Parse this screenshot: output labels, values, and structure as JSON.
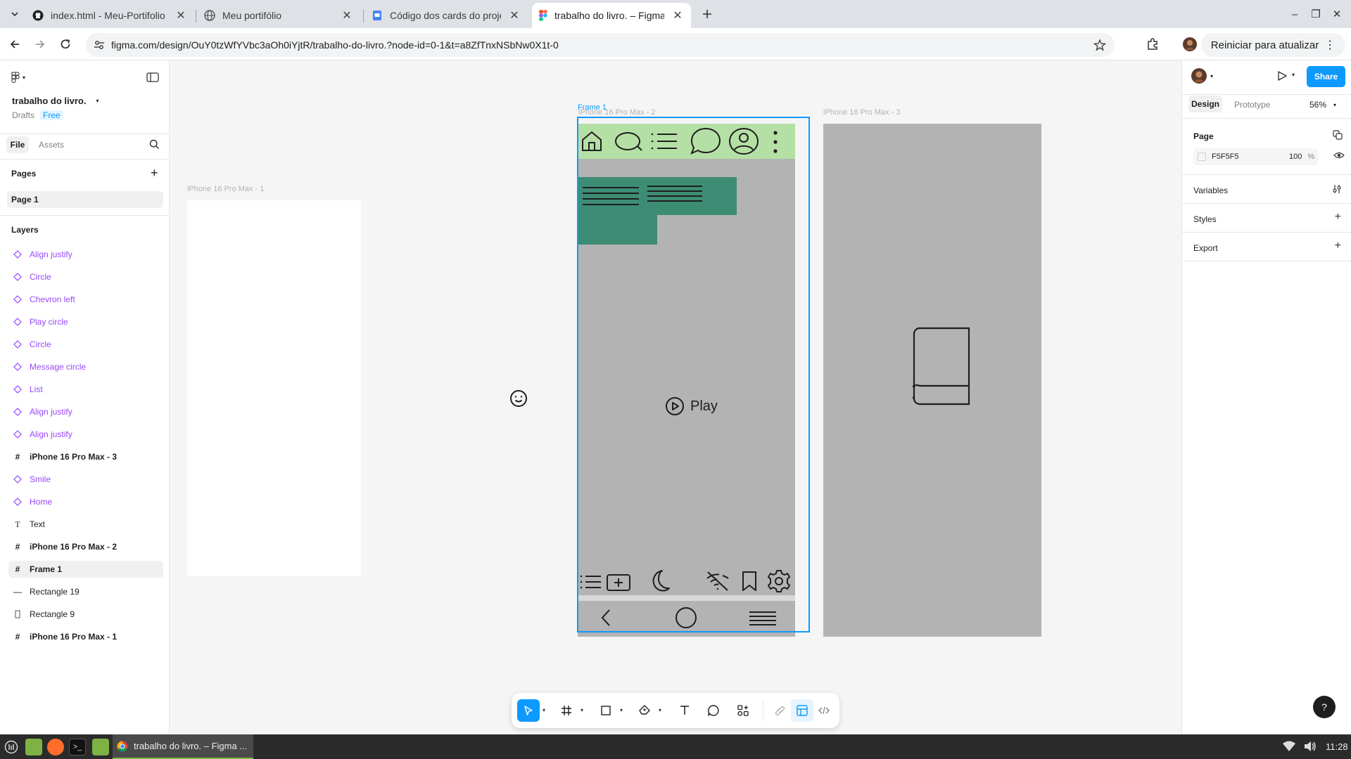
{
  "browser": {
    "tabs": [
      {
        "title": "index.html - Meu-Portifolio",
        "icon": "github-icon",
        "active": false
      },
      {
        "title": "Meu portifólio",
        "icon": "globe-icon",
        "active": false
      },
      {
        "title": "Código dos cards do projeto",
        "icon": "slides-icon",
        "active": false
      },
      {
        "title": "trabalho do livro. – Figma",
        "icon": "figma-icon",
        "active": true
      }
    ],
    "url": "figma.com/design/OuY0tzWfYVbc3aOh0iYjtR/trabalho-do-livro.?node-id=0-1&t=a8ZfTnxNSbNw0X1t-0",
    "update_button": "Reiniciar para atualizar"
  },
  "left_panel": {
    "file_name": "trabalho do livro.",
    "location": "Drafts",
    "plan_badge": "Free",
    "tabs": [
      "File",
      "Assets"
    ],
    "pages_heading": "Pages",
    "pages": [
      "Page 1"
    ],
    "layers_heading": "Layers",
    "layers": [
      {
        "name": "Align justify",
        "kind": "component"
      },
      {
        "name": "Circle",
        "kind": "component"
      },
      {
        "name": "Chevron left",
        "kind": "component"
      },
      {
        "name": "Play circle",
        "kind": "component"
      },
      {
        "name": "Circle",
        "kind": "component"
      },
      {
        "name": "Message circle",
        "kind": "component"
      },
      {
        "name": "List",
        "kind": "component"
      },
      {
        "name": "Align justify",
        "kind": "component"
      },
      {
        "name": "Align justify",
        "kind": "component"
      },
      {
        "name": "iPhone 16 Pro Max - 3",
        "kind": "frame"
      },
      {
        "name": "Smile",
        "kind": "component"
      },
      {
        "name": "Home",
        "kind": "component"
      },
      {
        "name": "Text",
        "kind": "text"
      },
      {
        "name": "iPhone 16 Pro Max - 2",
        "kind": "frame"
      },
      {
        "name": "Frame 1",
        "kind": "frame",
        "selected": true
      },
      {
        "name": "Rectangle 19",
        "kind": "line"
      },
      {
        "name": "Rectangle 9",
        "kind": "rect"
      },
      {
        "name": "iPhone 16 Pro Max - 1",
        "kind": "frame"
      }
    ]
  },
  "canvas": {
    "frame_labels": {
      "frame1": "Frame 1",
      "iphone1": "iPhone 16 Pro Max - 1",
      "iphone2": "iPhone 16 Pro Max - 2",
      "iphone3": "iPhone 16 Pro Max - 3"
    },
    "play_label": "Play",
    "colors": {
      "canvas_bg": "#f5f5f5",
      "phone_gray": "#b3b3b3",
      "header_green": "#b5e0a5",
      "teal_block": "#3d8c74",
      "selection_blue": "#0d99ff"
    }
  },
  "right_panel": {
    "user_avatar": "avatar",
    "share_label": "Share",
    "tabs": [
      "Design",
      "Prototype"
    ],
    "zoom": "56%",
    "page_heading": "Page",
    "page_color": "F5F5F5",
    "page_opacity": "100",
    "percent": "%",
    "sections": [
      "Variables",
      "Styles",
      "Export"
    ]
  },
  "help_label": "?",
  "taskbar": {
    "active_window": "trabalho do livro. – Figma ...",
    "clock": "11:28"
  }
}
